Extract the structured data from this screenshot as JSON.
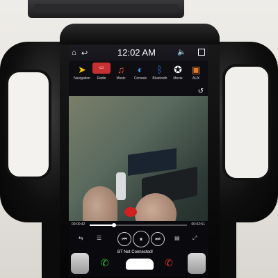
{
  "status_bar": {
    "time": "12:02 AM"
  },
  "apps": [
    {
      "label": "Navigation",
      "icon": "navigation-arrow-icon"
    },
    {
      "label": "Radio",
      "icon": "radio-icon"
    },
    {
      "label": "Music",
      "icon": "music-icon"
    },
    {
      "label": "Console",
      "icon": "console-icon"
    },
    {
      "label": "Bluetooth",
      "icon": "bluetooth-icon"
    },
    {
      "label": "Movie",
      "icon": "movie-icon"
    },
    {
      "label": "AUX",
      "icon": "aux-icon"
    }
  ],
  "player": {
    "elapsed": "00:00:42",
    "total": "00:02:51",
    "progress": 0.25
  },
  "call_bar": {
    "bt_status": "BT Not Connected!"
  },
  "colors": {
    "call_accept": "#2fbf3a",
    "call_reject": "#e03030",
    "nav_icon": "#f5c400"
  }
}
